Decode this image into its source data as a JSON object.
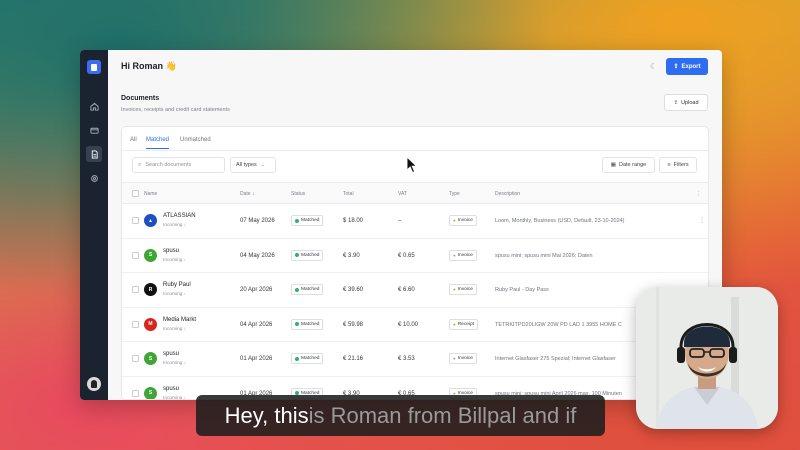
{
  "header": {
    "greeting": "Hi Roman 👋",
    "export_label": "Export",
    "theme_icon": "moon-icon"
  },
  "sidebar": {
    "items": [
      "home-icon",
      "card-icon",
      "document-icon",
      "settings-icon"
    ],
    "active": "document-icon"
  },
  "documents": {
    "title": "Documents",
    "subtitle": "Invoices, receipts and credit card statements",
    "upload_label": "Upload"
  },
  "tabs": [
    "All",
    "Matched",
    "Unmatched"
  ],
  "active_tab": "Matched",
  "toolbar": {
    "search_placeholder": "Search documents",
    "types_label": "All types",
    "date_range_label": "Date range",
    "filters_label": "Filters"
  },
  "table": {
    "columns": [
      "Name",
      "Date ↓",
      "Status",
      "Total",
      "VAT",
      "Type",
      "Description"
    ],
    "rows": [
      {
        "name": "ATLASSIAN",
        "direction": "Incoming ↓",
        "date": "07 May 2026",
        "status": "Matched",
        "total": "$ 18.00",
        "vat": "–",
        "type": "Invoice",
        "description": "Loom, Monthly, Business (USD, Default, 23-10-2024)",
        "icon_color": "#1d4fc0",
        "icon_glyph": "▲"
      },
      {
        "name": "spusu",
        "direction": "Incoming ↓",
        "date": "04 May 2026",
        "status": "Matched",
        "total": "€ 3.90",
        "vat": "€ 0.65",
        "type": "Invoice",
        "description": "spusu mini; spusu mini Mai 2026; Daten",
        "icon_color": "#3fa535",
        "icon_glyph": "S"
      },
      {
        "name": "Ruby Paul",
        "direction": "Incoming ↓",
        "date": "20 Apr 2026",
        "status": "Matched",
        "total": "€ 39.60",
        "vat": "€ 6.60",
        "type": "Invoice",
        "description": "Ruby Paul - Day Pass",
        "icon_color": "#111111",
        "icon_glyph": "R"
      },
      {
        "name": "Media Markt",
        "direction": "Incoming ↓",
        "date": "04 Apr 2026",
        "status": "Matched",
        "total": "€ 59.98",
        "vat": "€ 10.00",
        "type": "Receipt",
        "description": "TETRKITPD20LIGW 20W PD LAD 1 3955 HOME C",
        "icon_color": "#d8241c",
        "icon_glyph": "M"
      },
      {
        "name": "spusu",
        "direction": "Incoming ↓",
        "date": "01 Apr 2026",
        "status": "Matched",
        "total": "€ 21.16",
        "vat": "€ 3.53",
        "type": "Invoice",
        "description": "Internet Glasfaser 275 Spezial; Internet Glasfaser",
        "icon_color": "#3fa535",
        "icon_glyph": "S"
      },
      {
        "name": "spusu",
        "direction": "Incoming ↓",
        "date": "01 Apr 2026",
        "status": "Matched",
        "total": "€ 3.90",
        "vat": "€ 0.65",
        "type": "Invoice",
        "description": "spusu mini; spusu mini April 2026 max. 100 Minuten",
        "icon_color": "#3fa535",
        "icon_glyph": "S"
      }
    ]
  },
  "caption": {
    "bright": "Hey, this",
    "faded": " is Roman from Billpal and if"
  },
  "colors": {
    "accent": "#2f6df0",
    "sidebar": "#1b2330",
    "matched_dot": "#2fb36a",
    "incoming_arrow": "#e24c4c"
  }
}
